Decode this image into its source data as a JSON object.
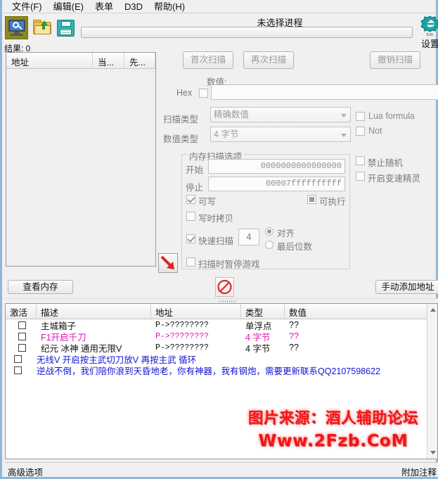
{
  "menubar": {
    "items": [
      {
        "label": "文件(F)",
        "name": "menu-file"
      },
      {
        "label": "编辑(E)",
        "name": "menu-edit"
      },
      {
        "label": "表单",
        "name": "menu-table"
      },
      {
        "label": "D3D",
        "name": "menu-d3d"
      },
      {
        "label": "帮助(H)",
        "name": "menu-help"
      }
    ]
  },
  "toolbar": {
    "icons": [
      "process-select-icon",
      "open-file-icon",
      "save-file-icon"
    ],
    "settings_label": "设置",
    "logo_icon": "gear-e-logo-icon"
  },
  "process": {
    "title": "未选择进程",
    "progress_percent": 0
  },
  "results": {
    "count_label": "结果: 0",
    "columns": [
      "地址",
      "当...",
      "先..."
    ],
    "rows": []
  },
  "scan": {
    "first_scan_label": "首次扫描",
    "next_scan_label": "再次扫描",
    "undo_scan_label": "撤销扫描",
    "value_label": "数值:",
    "value_input": "",
    "hex_label": "Hex",
    "hex_checked": false,
    "scan_type_label": "扫描类型",
    "scan_type_value": "精确数值",
    "value_type_label": "数值类型",
    "value_type_value": "4 字节",
    "lua_formula_label": "Lua formula",
    "lua_formula_checked": false,
    "not_label": "Not",
    "not_checked": false
  },
  "memopts": {
    "group_title": "内存扫描选项",
    "start_label": "开始",
    "start_value": "0000000000000000",
    "stop_label": "停止",
    "stop_value": "00007ffffffffff",
    "writable_label": "可写",
    "writable_checked": true,
    "executable_label": "可执行",
    "executable_state": "grayfill",
    "copyonwrite_label": "写时拷贝",
    "copyonwrite_checked": false,
    "fastscan_label": "快速扫描",
    "fastscan_checked": true,
    "fastscan_value": "4",
    "align_label": "对齐",
    "align_selected": true,
    "lastdigits_label": "最后位数",
    "lastdigits_selected": false,
    "pause_label": "扫描时暂停游戏",
    "pause_checked": false,
    "no_random_label": "禁止随机",
    "no_random_checked": false,
    "speedhack_label": "开启变速精灵",
    "speedhack_checked": false,
    "arrow_button_icon": "red-diagonal-arrow-icon"
  },
  "actions": {
    "view_memory_label": "查看内存",
    "add_address_label": "手动添加地址",
    "stop_icon": "no-entry-icon"
  },
  "cheattable": {
    "columns": [
      "激活",
      "描述",
      "地址",
      "类型",
      "数值"
    ],
    "rows": [
      {
        "active": false,
        "description": "主城箱子",
        "address": "P->????????",
        "type": "单浮点",
        "value": "??",
        "color": "#101010",
        "wide": false
      },
      {
        "active": false,
        "description": "F1开启千刀",
        "address": "P->????????",
        "type": "4 字节",
        "value": "??",
        "color": "#e612b8",
        "wide": false
      },
      {
        "active": false,
        "description": "纪元 冰神 通用无限V",
        "address": "P->????????",
        "type": "4 字节",
        "value": "??",
        "color": "#101010",
        "wide": false
      },
      {
        "active": false,
        "description": "  无线V   开启按主武切刀放V   再按主武   循环",
        "address": "",
        "type": "",
        "value": "",
        "color": "#1414d2",
        "wide": true
      },
      {
        "active": false,
        "description": "逆战不倒，我们陪你浪到天昏地老，你有神器，我有钢炮，需要更新联系QQ2107598622",
        "address": "",
        "type": "",
        "value": "",
        "color": "#1414d2",
        "wide": true
      }
    ]
  },
  "watermark": {
    "line1": "图片来源：酒人辅助论坛",
    "line2": "Www.2Fzb.CoM",
    "color": "#f21515"
  },
  "statusbar": {
    "left_label": "高级选项",
    "right_label": "附加注释"
  }
}
